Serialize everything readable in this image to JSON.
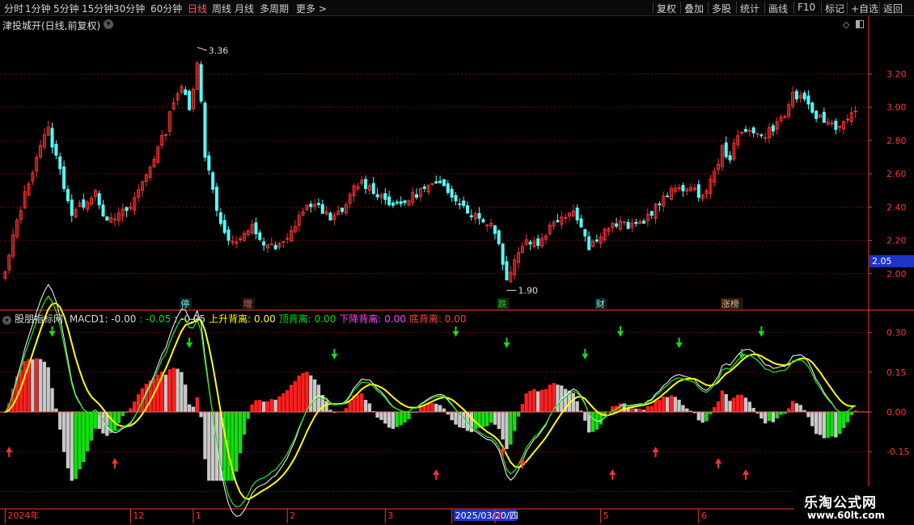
{
  "toolbar": {
    "periods": [
      "分时",
      "1分钟",
      "5分钟",
      "15分钟",
      "30分钟",
      "60分钟",
      "日线",
      "周线",
      "月线",
      "多周期",
      "更多 >"
    ],
    "active_period": "日线",
    "actions": [
      "复权",
      "叠加",
      "多股",
      "统计",
      "画线",
      "F10",
      "标记",
      "+自选",
      "返回"
    ]
  },
  "stock": {
    "title": "津投城开(日线,前复权)"
  },
  "indicator_header": {
    "name": "股朋指标网",
    "items": [
      {
        "text": "MACD1: -0.00",
        "color": "#dcdcdc"
      },
      {
        "text": ": -0.05",
        "color": "#00e000"
      },
      {
        "text": ": -0.05",
        "color": "#dcdcdc"
      },
      {
        "text": "上升背离: 0.00",
        "color": "#ffff00"
      },
      {
        "text": "顶背离: 0.00",
        "color": "#00e000"
      },
      {
        "text": "下降背离: 0.00",
        "color": "#ff40ff"
      },
      {
        "text": "底背离: 0.00",
        "color": "#ff4040"
      }
    ]
  },
  "current_price_tag": "2.05",
  "watermark": {
    "line1": "乐淘公式网",
    "line2": "www.60lt.com"
  },
  "colors": {
    "up": "#ff3030",
    "down": "#54ffff",
    "grid": "#7a0000",
    "axis": "#ff3333"
  },
  "chart_data": [
    {
      "type": "candlestick",
      "title": "津投城开(日线,前复权)",
      "ylim": [
        1.8,
        3.45
      ],
      "yticks": [
        2.0,
        2.2,
        2.4,
        2.6,
        2.8,
        3.0,
        3.2
      ],
      "high_label": "3.36",
      "low_label": "1.90",
      "current_price": 2.05,
      "close_anchors": [
        [
          0,
          2.0
        ],
        [
          3,
          2.32
        ],
        [
          6,
          2.55
        ],
        [
          9,
          2.78
        ],
        [
          11,
          2.86
        ],
        [
          14,
          2.62
        ],
        [
          17,
          2.36
        ],
        [
          20,
          2.42
        ],
        [
          23,
          2.5
        ],
        [
          26,
          2.3
        ],
        [
          29,
          2.35
        ],
        [
          32,
          2.4
        ],
        [
          35,
          2.55
        ],
        [
          38,
          2.7
        ],
        [
          41,
          2.86
        ],
        [
          43,
          3.05
        ],
        [
          45,
          3.13
        ],
        [
          47,
          2.98
        ],
        [
          48,
          3.1
        ],
        [
          49,
          3.29
        ],
        [
          50,
          3.05
        ],
        [
          51,
          2.72
        ],
        [
          53,
          2.5
        ],
        [
          55,
          2.3
        ],
        [
          58,
          2.18
        ],
        [
          61,
          2.22
        ],
        [
          63,
          2.28
        ],
        [
          66,
          2.18
        ],
        [
          69,
          2.15
        ],
        [
          72,
          2.2
        ],
        [
          75,
          2.35
        ],
        [
          78,
          2.42
        ],
        [
          81,
          2.38
        ],
        [
          84,
          2.33
        ],
        [
          87,
          2.4
        ],
        [
          89,
          2.52
        ],
        [
          91,
          2.55
        ],
        [
          94,
          2.5
        ],
        [
          97,
          2.45
        ],
        [
          100,
          2.4
        ],
        [
          103,
          2.45
        ],
        [
          106,
          2.5
        ],
        [
          109,
          2.53
        ],
        [
          112,
          2.52
        ],
        [
          115,
          2.46
        ],
        [
          118,
          2.38
        ],
        [
          121,
          2.33
        ],
        [
          124,
          2.3
        ],
        [
          126,
          2.2
        ],
        [
          127,
          2.05
        ],
        [
          128,
          1.96
        ],
        [
          130,
          2.1
        ],
        [
          133,
          2.2
        ],
        [
          136,
          2.18
        ],
        [
          139,
          2.28
        ],
        [
          142,
          2.35
        ],
        [
          145,
          2.38
        ],
        [
          147,
          2.3
        ],
        [
          149,
          2.15
        ],
        [
          151,
          2.22
        ],
        [
          154,
          2.28
        ],
        [
          157,
          2.3
        ],
        [
          160,
          2.28
        ],
        [
          163,
          2.32
        ],
        [
          166,
          2.4
        ],
        [
          169,
          2.47
        ],
        [
          172,
          2.53
        ],
        [
          175,
          2.5
        ],
        [
          178,
          2.47
        ],
        [
          181,
          2.6
        ],
        [
          183,
          2.75
        ],
        [
          185,
          2.7
        ],
        [
          187,
          2.82
        ],
        [
          190,
          2.88
        ],
        [
          193,
          2.82
        ],
        [
          196,
          2.88
        ],
        [
          199,
          2.95
        ],
        [
          201,
          3.08
        ],
        [
          203,
          3.05
        ],
        [
          205,
          3.0
        ],
        [
          207,
          2.95
        ],
        [
          209,
          2.92
        ],
        [
          211,
          2.9
        ],
        [
          213,
          2.88
        ],
        [
          215,
          2.95
        ]
      ],
      "events": [
        {
          "label": "停",
          "index": 46,
          "color": "#54ffff"
        },
        {
          "label": "增",
          "index": 62,
          "color": "#ff5050"
        },
        {
          "label": "跌",
          "index": 127,
          "color": "#00e000"
        },
        {
          "label": "财",
          "index": 152,
          "color": "#54ffff"
        },
        {
          "label": "涨榜",
          "index": 184,
          "color": "#ffb070"
        }
      ]
    },
    {
      "type": "macd",
      "ylim": [
        -0.36,
        0.36
      ],
      "yticks": [
        0.3,
        0.15,
        0.0,
        -0.15,
        -0.3
      ],
      "x_labels": [
        {
          "text": "2024年",
          "index": 0
        },
        {
          "text": "12",
          "index": 32
        },
        {
          "text": "1",
          "index": 48
        },
        {
          "text": "2",
          "index": 72
        },
        {
          "text": "3",
          "index": 97
        },
        {
          "text": "2025/03/20/四",
          "index": 114
        },
        {
          "text": "4",
          "index": 125
        },
        {
          "text": "5",
          "index": 152
        },
        {
          "text": "6",
          "index": 177
        }
      ],
      "down_arrows": [
        12,
        47,
        84,
        115,
        128,
        148,
        157,
        172,
        188,
        193
      ],
      "up_arrows": [
        1,
        28,
        110,
        127,
        132,
        155,
        166,
        182,
        189
      ]
    }
  ]
}
